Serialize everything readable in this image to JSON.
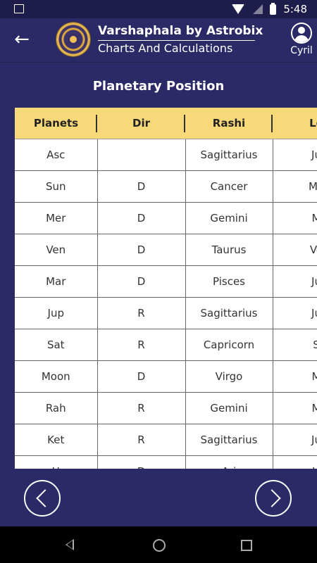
{
  "status": {
    "time": "5:48"
  },
  "header": {
    "title": "Varshaphala by Astrobix",
    "subtitle": "Charts And Calculations",
    "user_name": "Cyril"
  },
  "section_title": "Planetary Position",
  "table": {
    "columns": [
      "Planets",
      "Dir",
      "Rashi",
      "Lo"
    ],
    "rows": [
      [
        "Asc",
        "",
        "Sagittarius",
        "Ju"
      ],
      [
        "Sun",
        "D",
        "Cancer",
        "Mo"
      ],
      [
        "Mer",
        "D",
        "Gemini",
        "M"
      ],
      [
        "Ven",
        "D",
        "Taurus",
        "Ve"
      ],
      [
        "Mar",
        "D",
        "Pisces",
        "Ju"
      ],
      [
        "Jup",
        "R",
        "Sagittarius",
        "Ju"
      ],
      [
        "Sat",
        "R",
        "Capricorn",
        "S"
      ],
      [
        "Moon",
        "D",
        "Virgo",
        "M"
      ],
      [
        "Rah",
        "R",
        "Gemini",
        "M"
      ],
      [
        "Ket",
        "R",
        "Sagittarius",
        "Ju"
      ],
      [
        "U",
        "D",
        "Ari",
        "V"
      ]
    ]
  },
  "colors": {
    "header_bg": "#2c2a66",
    "table_header_bg": "#f8d97a"
  }
}
